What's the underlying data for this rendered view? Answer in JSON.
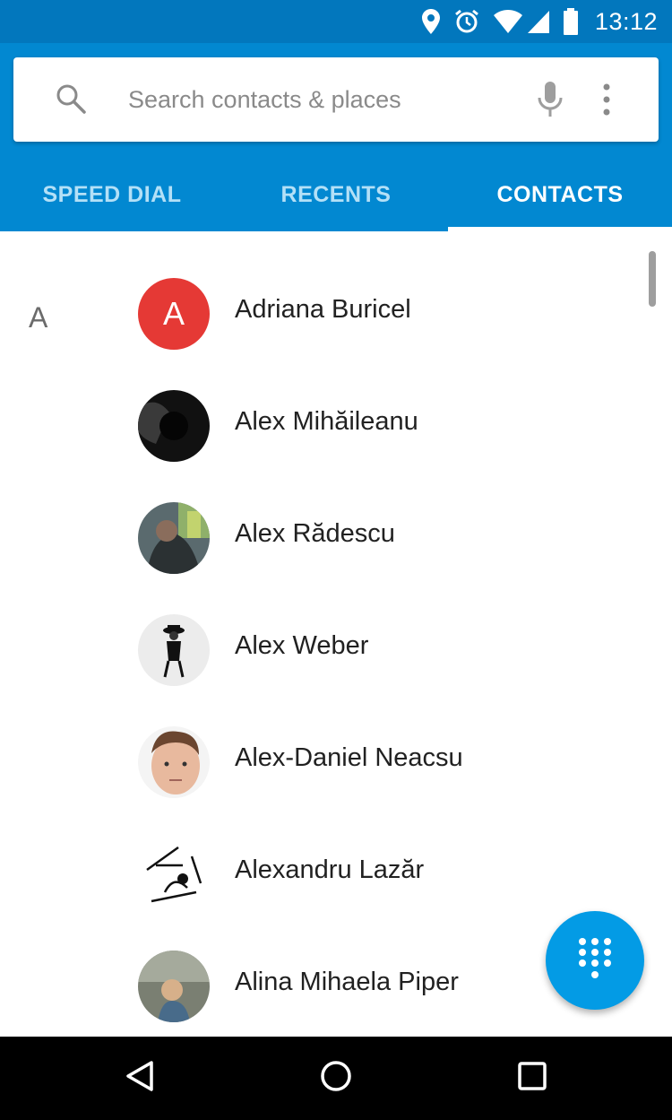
{
  "status_bar": {
    "time": "13:12",
    "icons": [
      "location-icon",
      "alarm-icon",
      "wifi-icon",
      "cell-signal-icon",
      "battery-icon"
    ]
  },
  "search": {
    "placeholder": "Search contacts & places"
  },
  "tabs": [
    {
      "label": "SPEED DIAL",
      "active": false
    },
    {
      "label": "RECENTS",
      "active": false
    },
    {
      "label": "CONTACTS",
      "active": true
    }
  ],
  "contacts": {
    "section_letter": "A",
    "items": [
      {
        "name": "Adriana Buricel",
        "avatar_letter": "A"
      },
      {
        "name": "Alex Mihăileanu",
        "avatar_letter": ""
      },
      {
        "name": "Alex Rădescu",
        "avatar_letter": ""
      },
      {
        "name": "Alex Weber",
        "avatar_letter": ""
      },
      {
        "name": "Alex-Daniel Neacsu",
        "avatar_letter": ""
      },
      {
        "name": "Alexandru Lazăr",
        "avatar_letter": ""
      },
      {
        "name": "Alina Mihaela Piper",
        "avatar_letter": ""
      }
    ]
  },
  "colors": {
    "status_bar": "#0277BD",
    "app_bar": "#0288D1",
    "fab": "#039BE5",
    "avatar_red": "#E53935"
  }
}
